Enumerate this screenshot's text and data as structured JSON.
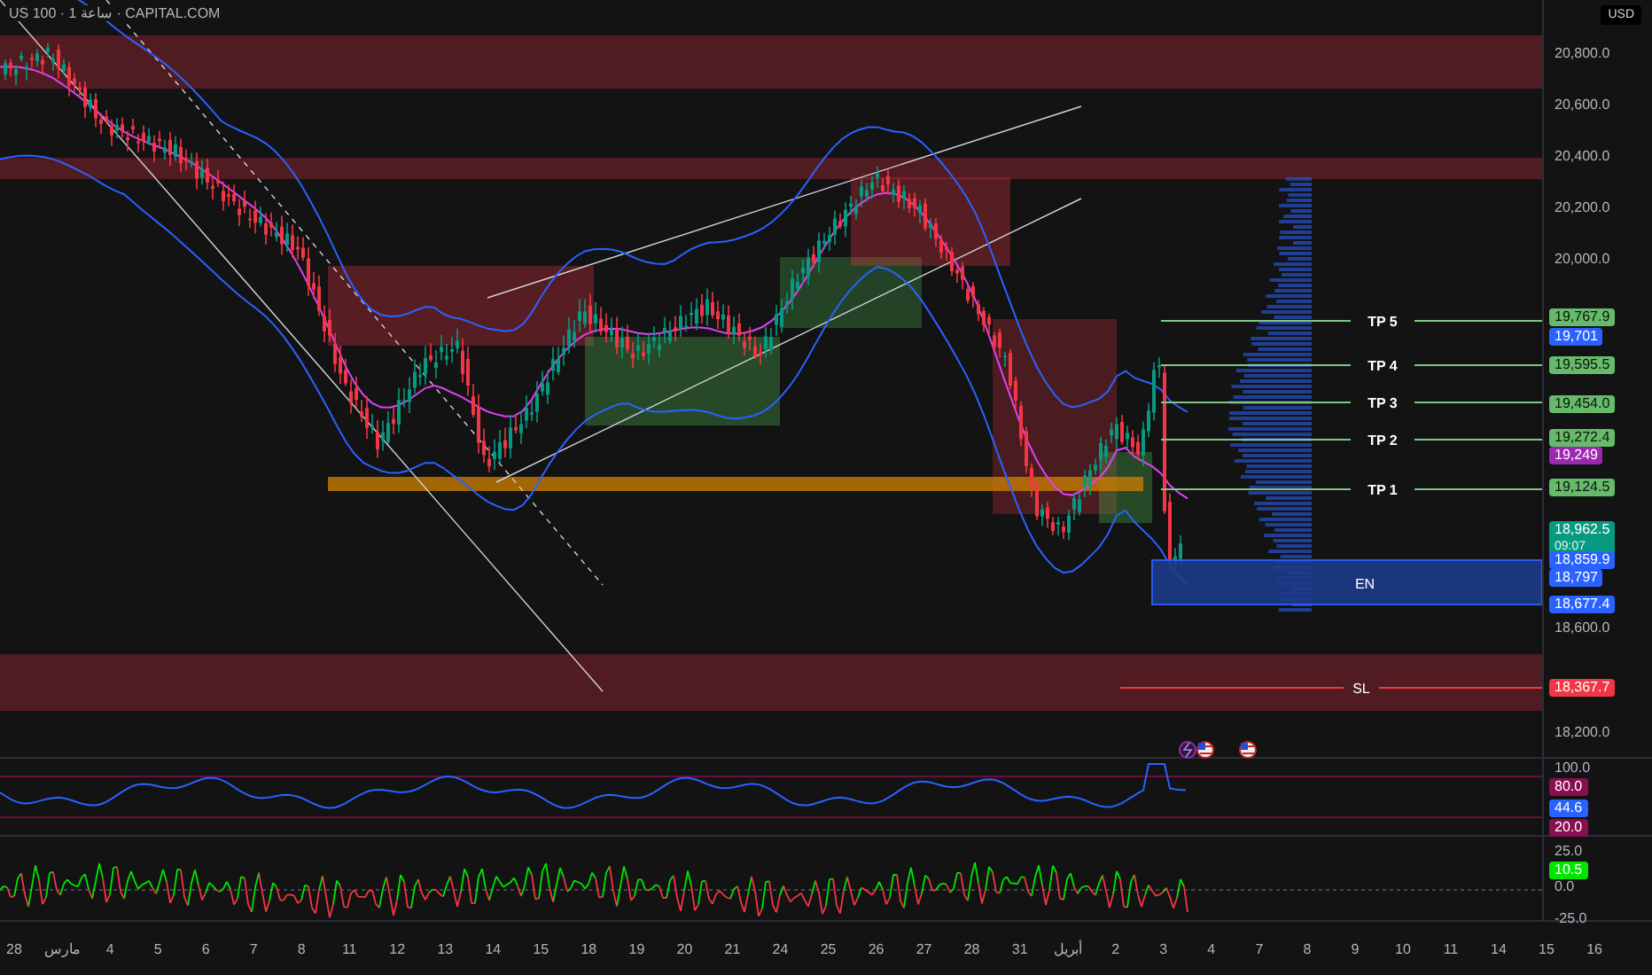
{
  "header": {
    "symbol": "US 100 · 1 ساعة · CAPITAL.COM",
    "currency": "USD"
  },
  "levels": [
    {
      "label": "TP 5",
      "kind": "target"
    },
    {
      "label": "TP 4",
      "kind": "target"
    },
    {
      "label": "TP 3",
      "kind": "target"
    },
    {
      "label": "TP 2",
      "kind": "target"
    },
    {
      "label": "TP 1",
      "kind": "target"
    },
    {
      "label": "EN",
      "kind": "entry"
    },
    {
      "label": "SL",
      "kind": "stop"
    }
  ],
  "price_axis": {
    "ticks": [
      "20,800.0",
      "20,600.0",
      "20,400.0",
      "20,200.0",
      "20,000.0",
      "18,600.0",
      "18,200.0"
    ]
  },
  "price_tags": [
    {
      "value": "19,767.9",
      "color": "#66bb6a"
    },
    {
      "value": "19,701",
      "color": "#2962ff"
    },
    {
      "value": "19,595.5",
      "color": "#66bb6a"
    },
    {
      "value": "19,454.0",
      "color": "#66bb6a"
    },
    {
      "value": "19,272.4",
      "color": "#66bb6a"
    },
    {
      "value": "19,249",
      "color": "#9c27b0"
    },
    {
      "value": "19,124.5",
      "color": "#66bb6a"
    },
    {
      "value": "18,962.5",
      "countdown": "09:07",
      "color": "#089981"
    },
    {
      "value": "18,859.9",
      "color": "#2962ff"
    },
    {
      "value": "18,797",
      "color": "#2962ff"
    },
    {
      "value": "18,677.4",
      "color": "#2962ff"
    },
    {
      "value": "18,367.7",
      "color": "#f23645"
    }
  ],
  "oscillator": {
    "ticks": [
      "100.0"
    ],
    "tags": [
      {
        "value": "80.0",
        "color": "#880e4f"
      },
      {
        "value": "44.6",
        "color": "#2962ff"
      },
      {
        "value": "20.0",
        "color": "#880e4f"
      }
    ]
  },
  "momentum": {
    "ticks": [
      "25.0",
      "0.0",
      "-25.0"
    ],
    "tags": [
      {
        "value": "10.5",
        "color": "#00e600"
      }
    ]
  },
  "time_axis": {
    "labels": [
      "28",
      "مارس",
      "4",
      "5",
      "6",
      "7",
      "8",
      "11",
      "12",
      "13",
      "14",
      "15",
      "18",
      "19",
      "20",
      "21",
      "24",
      "25",
      "26",
      "27",
      "28",
      "31",
      "أبريل",
      "2",
      "3",
      "4",
      "7",
      "8",
      "9",
      "10",
      "11",
      "14",
      "15",
      "16"
    ]
  }
}
